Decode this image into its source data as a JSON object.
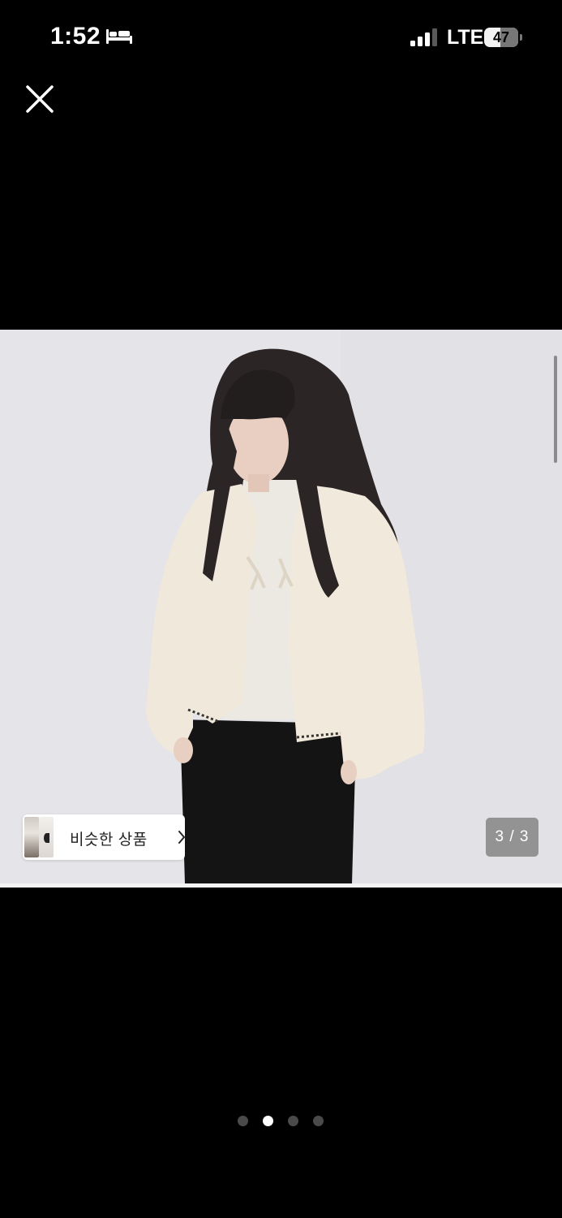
{
  "status_bar": {
    "time": "1:52",
    "network": "LTE",
    "battery": "47",
    "battery_fraction": 0.47
  },
  "close_icon": "close-icon",
  "product_photo": {
    "image_counter": "3 / 3"
  },
  "similar_products": {
    "label": "비슷한 상품",
    "chevron_icon": "chevron-right-icon"
  },
  "pagination": {
    "count": 4,
    "active_index": 1
  },
  "colors": {
    "background": "#000000",
    "photo_background": "#e4e3e7",
    "active_dot": "#ffffff",
    "inactive_dot": "#4a4a4a"
  }
}
